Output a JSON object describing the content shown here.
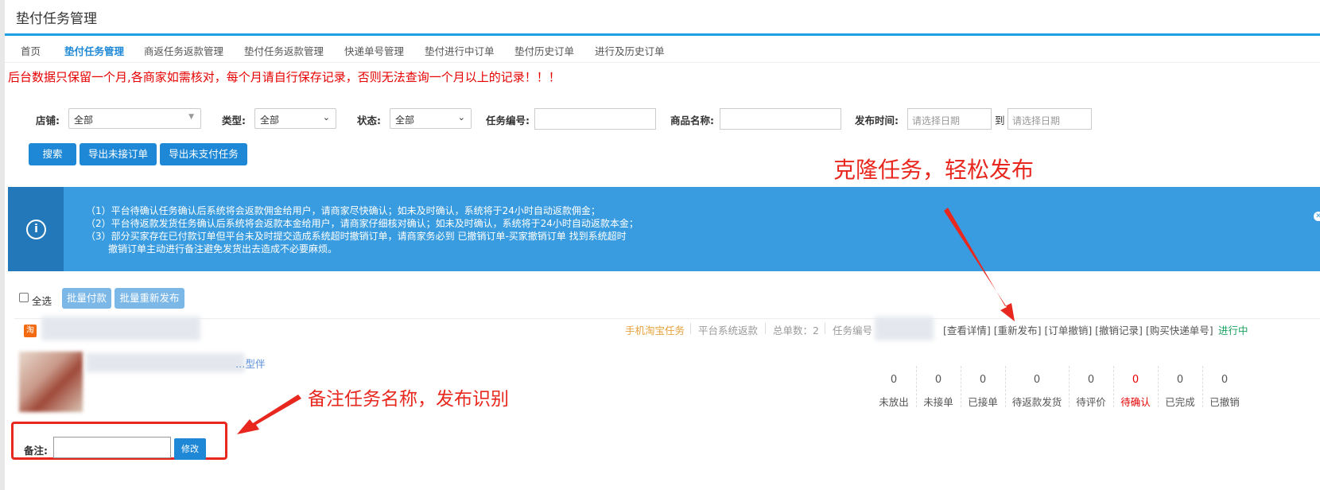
{
  "page_title": "垫付任务管理",
  "nav": [
    "首页",
    "垫付任务管理",
    "商返任务返款管理",
    "垫付任务返款管理",
    "快递单号管理",
    "垫付进行中订单",
    "垫付历史订单",
    "进行及历史订单"
  ],
  "warning": "后台数据只保留一个月,各商家如需核对，每个月请自行保存记录，否则无法查询一个月以上的记录！！！",
  "filters": {
    "shop_label": "店铺:",
    "shop_value": "全部",
    "type_label": "类型:",
    "type_value": "全部",
    "status_label": "状态:",
    "status_value": "全部",
    "taskno_label": "任务编号:",
    "product_label": "商品名称:",
    "time_label": "发布时间:",
    "date_placeholder": "请选择日期",
    "to": "到"
  },
  "actions": {
    "search": "搜索",
    "export_unaccepted": "导出未接订单",
    "export_unpaid": "导出未支付任务"
  },
  "notice": {
    "line1": "（1）平台待确认任务确认后系统将会返款佣金给用户，请商家尽快确认；如未及时确认，系统将于24小时自动返款佣金；",
    "line2": "（2）平台待返款发货任务确认后系统将会返款本金给用户，请商家仔细核对确认；如未及时确认，系统将于24小时自动返款本金；",
    "line3": "（3）部分买家存在已付款订单但平台未及时提交造成系统超时撤销订单，请商家务必到 已撤销订单-买家撤销订单 找到系统超时",
    "line4": "撤销订单主动进行备注避免发货出去造成不必要麻烦。"
  },
  "batch": {
    "select_all": "全选",
    "batch_pay": "批量付款",
    "batch_republish": "批量重新发布"
  },
  "order": {
    "tb_icon": "淘",
    "task_type": "手机淘宝任务",
    "refund_type": "平台系统返款",
    "total_label": "总单数：2",
    "taskno_label": "任务编号",
    "links": "[查看详情] [重新发布] [订单撤销] [撤销记录] [购买快递单号]",
    "status": "进行中",
    "product_name_fragment": "…型伴",
    "stats": [
      {
        "value": "0",
        "label": "未放出"
      },
      {
        "value": "0",
        "label": "未接单"
      },
      {
        "value": "0",
        "label": "已接单"
      },
      {
        "value": "0",
        "label": "待返款发货"
      },
      {
        "value": "0",
        "label": "待评价"
      },
      {
        "value": "0",
        "label": "待确认"
      },
      {
        "value": "0",
        "label": "已完成"
      },
      {
        "value": "0",
        "label": "已撤销"
      }
    ],
    "note_label": "备注:",
    "note_button": "修改"
  },
  "annotations": {
    "clone": "克隆任务，轻松发布",
    "remark": "备注任务名称，发布识别"
  },
  "colors": {
    "accent": "#1e88d6",
    "banner": "#3a9ce0",
    "warning": "#e60000",
    "annotation": "#e8281e",
    "status_green": "#19a15f",
    "task_type": "#e6a23c"
  }
}
